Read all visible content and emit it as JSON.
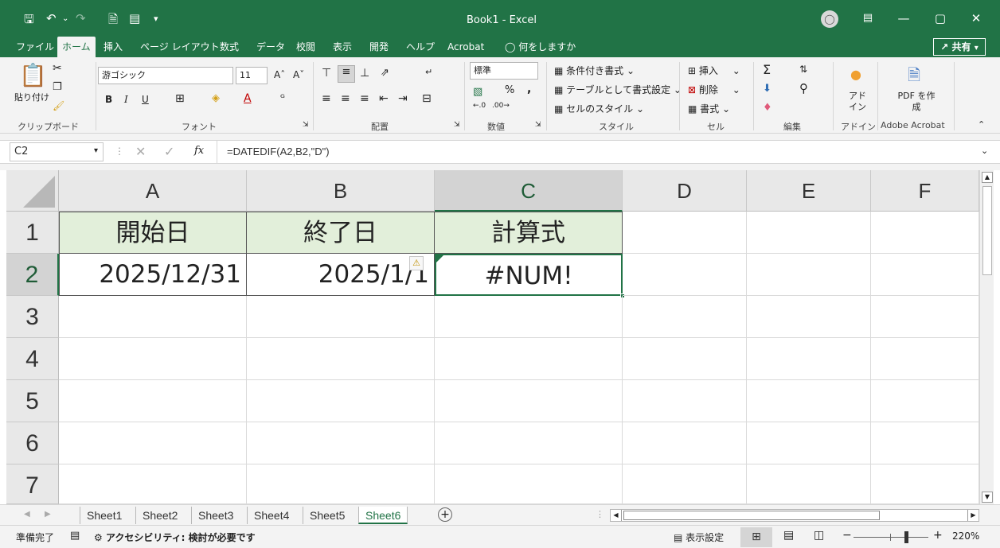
{
  "app": {
    "title": "Book1  -  Excel",
    "colors": {
      "brand": "#217346",
      "header_fill": "#e2efda"
    }
  },
  "title_bar": {
    "icons": [
      "save-icon",
      "undo-icon",
      "redo-icon",
      "print-preview-icon",
      "form-icon",
      "customize-qat-icon"
    ],
    "window_icons": [
      "avatar-icon",
      "ribbon-display-icon",
      "minimize-icon",
      "maximize-icon",
      "close-icon"
    ]
  },
  "menu": {
    "tabs": [
      "ファイル",
      "ホーム",
      "挿入",
      "ページ レイアウト",
      "数式",
      "データ",
      "校閲",
      "表示",
      "開発",
      "ヘルプ",
      "Acrobat"
    ],
    "search": "何をしますか",
    "share": "共有"
  },
  "ribbon": {
    "clipboard": {
      "paste": "貼り付け",
      "label": "クリップボード"
    },
    "font": {
      "name": "游ゴシック",
      "size": "11",
      "bold": "B",
      "italic": "I",
      "underline": "U",
      "label": "フォント"
    },
    "alignment": {
      "label": "配置"
    },
    "number": {
      "format": "標準",
      "percent": "%",
      "comma": ",",
      "label": "数値"
    },
    "styles": {
      "conditional": "条件付き書式",
      "as_table": "テーブルとして書式設定",
      "cell_styles": "セルのスタイル",
      "label": "スタイル"
    },
    "cells": {
      "insert": "挿入",
      "delete": "削除",
      "format": "書式",
      "label": "セル"
    },
    "editing": {
      "label": "編集"
    },
    "addins": {
      "button": "アド イン",
      "label": "アドイン"
    },
    "acrobat": {
      "button": "PDF を作成",
      "label": "Adobe Acrobat"
    }
  },
  "formula_bar": {
    "name_box": "C2",
    "fx": "fx",
    "formula": "=DATEDIF(A2,B2,\"D\")"
  },
  "sheet": {
    "columns": [
      "A",
      "B",
      "C",
      "D",
      "E",
      "F"
    ],
    "rows": [
      "1",
      "2",
      "3",
      "4",
      "5",
      "6",
      "7"
    ],
    "cells": {
      "A1": "開始日",
      "B1": "終了日",
      "C1": "計算式",
      "A2": "2025/12/31",
      "B2": "2025/1/1",
      "C2": "#NUM!"
    }
  },
  "sheet_tabs": [
    "Sheet1",
    "Sheet2",
    "Sheet3",
    "Sheet4",
    "Sheet5",
    "Sheet6"
  ],
  "active_sheet": "Sheet6",
  "status_bar": {
    "ready": "準備完了",
    "accessibility": "アクセシビリティ: 検討が必要です",
    "display_settings": "表示設定",
    "zoom": "220%"
  }
}
